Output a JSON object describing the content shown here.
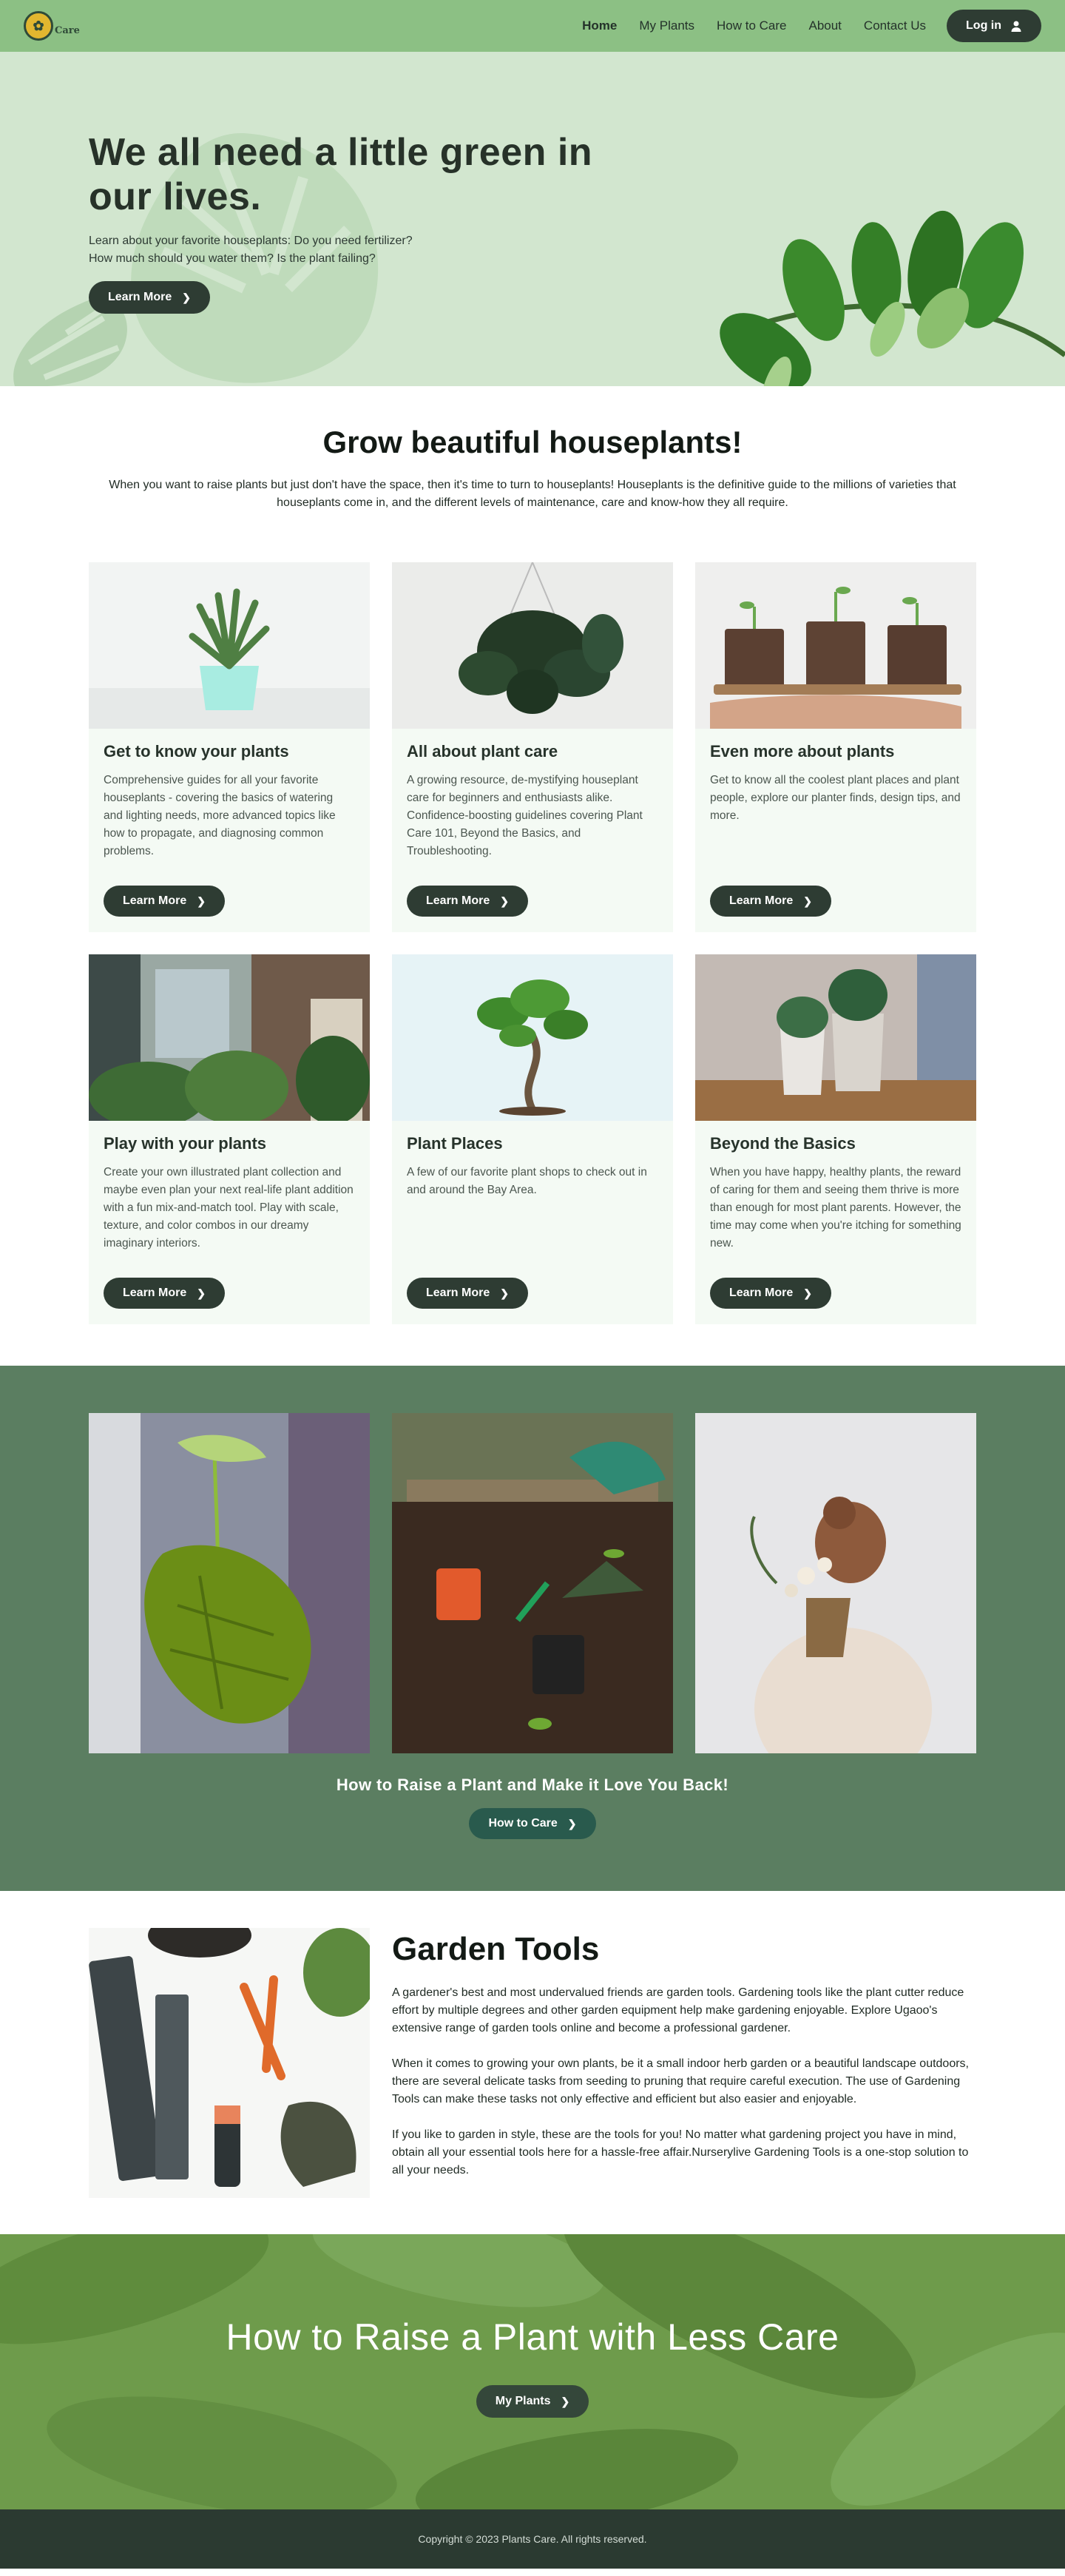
{
  "nav": {
    "logo_text": "Care",
    "links": [
      {
        "label": "Home",
        "active": true
      },
      {
        "label": "My Plants",
        "active": false
      },
      {
        "label": "How to Care",
        "active": false
      },
      {
        "label": "About",
        "active": false
      },
      {
        "label": "Contact Us",
        "active": false
      }
    ],
    "login_label": "Log in"
  },
  "hero": {
    "title": "We all need a little green in our lives.",
    "text": "Learn about your favorite houseplants: Do you need fertilizer? How much should you water them? Is the plant failing?",
    "button_label": "Learn More"
  },
  "intro": {
    "title": "Grow beautiful houseplants!",
    "text": "When you want to raise plants but just don't have the space, then it's time to turn to houseplants! Houseplants is the definitive guide to the millions of varieties that houseplants come in, and the different levels of maintenance, care and know-how they all require."
  },
  "cards": [
    {
      "title": "Get to know your plants",
      "text": "Comprehensive guides for all your favorite houseplants - covering the basics of watering and lighting needs, more advanced topics like how to propagate, and diagnosing common problems.",
      "button_label": "Learn More"
    },
    {
      "title": "All about plant care",
      "text": "A growing resource, de-mystifying houseplant care for beginners and enthusiasts alike. Confidence-boosting guidelines covering Plant Care 101, Beyond the Basics, and Troubleshooting.",
      "button_label": "Learn More"
    },
    {
      "title": "Even more about plants",
      "text": "Get to know all the coolest plant places and plant people, explore our planter finds, design tips, and more.",
      "button_label": "Learn More"
    },
    {
      "title": "Play with your plants",
      "text": "Create your own illustrated plant collection and maybe even plan your next real-life plant addition with a fun mix-and-match tool. Play with scale, texture, and color combos in our dreamy imaginary interiors.",
      "button_label": "Learn More"
    },
    {
      "title": "Plant Places",
      "text": "A few of our favorite plant shops to check out in and around the Bay Area.",
      "button_label": "Learn More"
    },
    {
      "title": "Beyond the Basics",
      "text": "When you have happy, healthy plants, the reward of caring for them and seeing them thrive is more than enough for most plant parents. However, the time may come when you're itching for something new.",
      "button_label": "Learn More"
    }
  ],
  "gallery": {
    "caption": "How to Raise a Plant and Make it Love You Back!",
    "button_label": "How to Care"
  },
  "tools": {
    "title": "Garden Tools",
    "paragraphs": [
      "A gardener's best and most undervalued friends are garden tools. Gardening tools like the plant cutter reduce effort by multiple degrees and other garden equipment help make gardening enjoyable. Explore Ugaoo's extensive range of garden tools online and become a professional gardener.",
      "When it comes to growing your own plants, be it a small indoor herb garden or a beautiful landscape outdoors, there are several delicate tasks from seeding to pruning that require careful execution. The use of Gardening Tools can make these tasks not only effective and efficient but also easier and enjoyable.",
      "If you like to garden in style, these are the tools for you! No matter what gardening project you have in mind, obtain all your essential tools here for a hassle-free affair.Nurserylive Gardening Tools is a one-stop solution to all your needs."
    ]
  },
  "cta": {
    "title": "How to Raise a Plant with Less Care",
    "button_label": "My Plants"
  },
  "footer": {
    "copyright": "Copyright © 2023 Plants Care. All rights reserved."
  },
  "icons": {
    "chevron": "chevron-right-icon",
    "user": "user-icon"
  },
  "colors": {
    "nav_bg": "#8cc084",
    "hero_bg": "#d2e6cf",
    "button_dark": "#2e3c33",
    "gallery_bg": "#5b7e61",
    "button_teal": "#295a4d",
    "cta_bg": "#6f9b4c",
    "footer_bg": "#2b3a31"
  }
}
